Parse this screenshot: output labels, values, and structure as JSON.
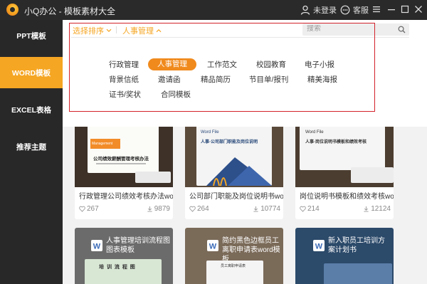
{
  "app": {
    "title": "小Q办公 - 模板素材大全"
  },
  "titlebar": {
    "login_label": "未登录",
    "service_label": "客服"
  },
  "sidebar": {
    "items": [
      {
        "label": "PPT模板"
      },
      {
        "label": "WORD模板"
      },
      {
        "label": "EXCEL表格"
      },
      {
        "label": "推荐主题"
      }
    ],
    "active": "WORD模板"
  },
  "filter": {
    "sort_label": "选择排序",
    "category_label": "人事管理",
    "search_placeholder": "搜索"
  },
  "tags": {
    "row1": [
      "行政管理",
      "人事管理",
      "工作范文",
      "校园教育",
      "电子小报"
    ],
    "row2": [
      "背景信纸",
      "邀请函",
      "精品简历",
      "节目单/报刊",
      "精美海报"
    ],
    "row3": [
      "证书/奖状",
      "合同模板"
    ],
    "active": "人事管理"
  },
  "cards": [
    {
      "title": "行政管理公司绩效考核办法word文档",
      "likes": "267",
      "downloads": "9879",
      "thumb_heading": "公司绩效薪酬管理考核办法",
      "thumb_sub": "Management system"
    },
    {
      "title": "公司部门职能及岗位说明书word模板",
      "likes": "264",
      "downloads": "10774",
      "thumb_heading": "人事·公司部门职能及岗位说明",
      "thumb_sub": "Word File"
    },
    {
      "title": "岗位说明书模板和绩效考核word文档",
      "likes": "214",
      "downloads": "12124",
      "thumb_heading": "人事·岗位说明书模板和绩效考核",
      "thumb_sub": "Word File"
    },
    {
      "title": "人事管理培训流程图图表模板",
      "thumb_heading": "培 训 流 程 图"
    },
    {
      "title": "简约黑色边框员工离职申请表word模板",
      "thumb_heading": "员工离职申请表"
    },
    {
      "title": "新入职员工培训方案计划书"
    }
  ],
  "colors": {
    "accent": "#f5a623",
    "active_tag": "#f08a1d",
    "highlight_border": "#d3222a",
    "titlebar": "#2a2a2a",
    "sidebar": "#282828"
  }
}
